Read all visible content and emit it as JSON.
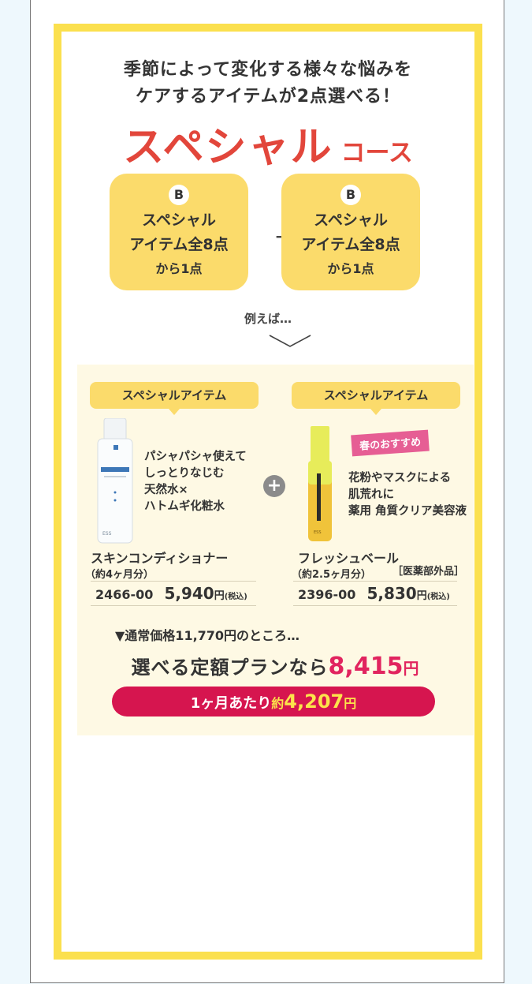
{
  "headline": {
    "line1": "季節によって変化する様々な悩みを",
    "line2": "ケアするアイテムが2点選べる！"
  },
  "course": {
    "title": "スペシャル",
    "suffix": "コース"
  },
  "choice_boxes": [
    {
      "badge": "B",
      "line1": "スペシャル",
      "line2": "アイテム全8点",
      "line3": "から1点"
    },
    {
      "badge": "B",
      "line1": "スペシャル",
      "line2": "アイテム全8点",
      "line3": "から1点"
    }
  ],
  "plus_symbol": "＋",
  "example_label": "例えば…",
  "products": [
    {
      "category": "スペシャルアイテム",
      "desc": [
        "パシャパシャ使えて",
        "しっとりなじむ",
        "天然水×",
        "ハトムギ化粧水"
      ],
      "name": "スキンコンディショナー",
      "sub": "（約4ヶ月分）",
      "code": "2466-00",
      "price": "5,940",
      "yen": "円",
      "tax": "(税込)",
      "bottle_label": "SKIN CONDITIONER",
      "brand": "ESS"
    },
    {
      "category": "スペシャルアイテム",
      "tag": "春のおすすめ",
      "desc": [
        "花粉やマスクによる",
        "肌荒れに",
        "薬用 角質クリア美容液"
      ],
      "name": "フレッシュベール",
      "sub": "（約2.5ヶ月分）",
      "quasi": "［医薬部外品］",
      "code": "2396-00",
      "price": "5,830",
      "yen": "円",
      "tax": "(税込)",
      "bottle_label": "FRESH VEIL",
      "brand": "ESS"
    }
  ],
  "circle_plus": "+",
  "pricing": {
    "normal": "▼通常価格11,770円のところ…",
    "plan_prefix": "選べる定額プランなら",
    "plan_price": "8,415",
    "plan_yen": "円",
    "monthly_prefix": "1ヶ月あたり",
    "monthly_yaku": "約",
    "monthly_price": "4,207",
    "monthly_yen": "円"
  },
  "colors": {
    "frame_yellow": "#fbe04e",
    "box_yellow": "#fbdb6b",
    "title_red": "#e2463b",
    "price_pink": "#e1245f",
    "tag_pink": "#e65e94"
  }
}
